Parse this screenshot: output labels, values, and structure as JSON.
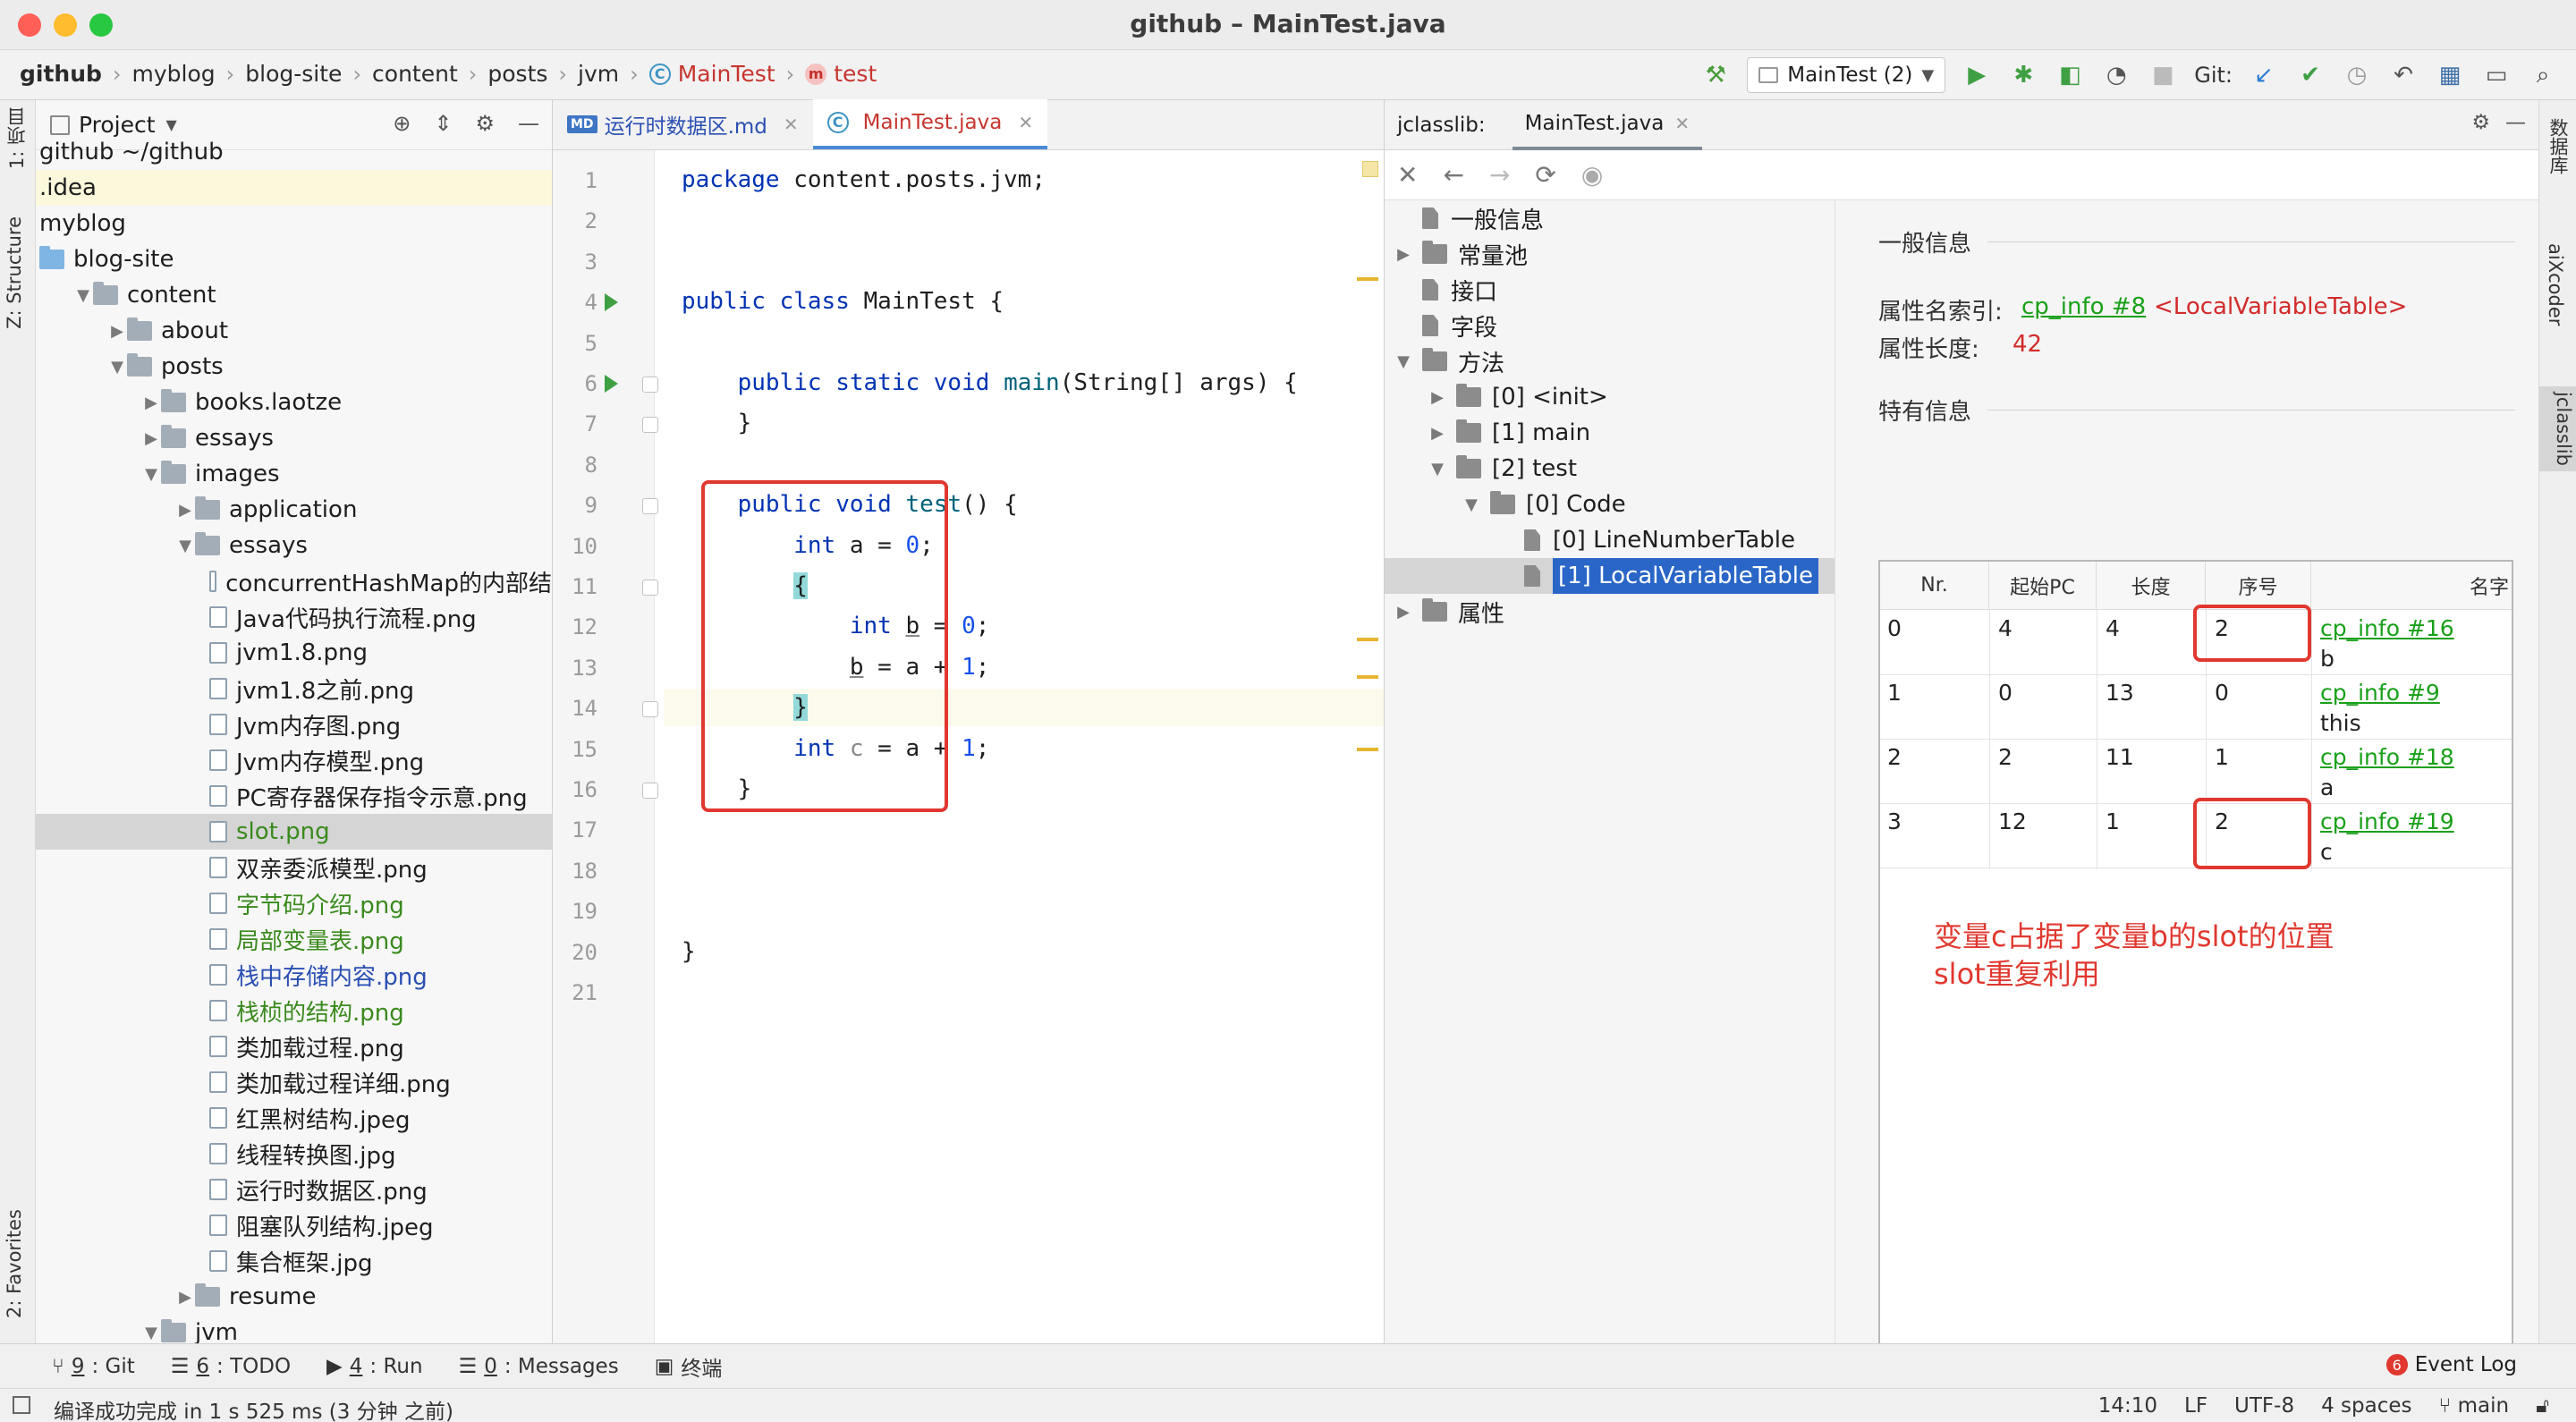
{
  "window": {
    "title": "github – MainTest.java"
  },
  "breadcrumb": [
    "github",
    "myblog",
    "blog-site",
    "content",
    "posts",
    "jvm",
    "MainTest",
    "test"
  ],
  "toolbar": {
    "run_config": "MainTest (2)",
    "git_label": "Git:"
  },
  "left_strip": {
    "project_tab": "1: 项目",
    "structure_tab": "Z: Structure",
    "favorites_tab": "2: Favorites"
  },
  "right_strip": {
    "database_tab": "数据库",
    "aixcoder_tab": "aiXcoder",
    "jclasslib_tab": "jclasslib"
  },
  "project": {
    "title": "Project",
    "tree": [
      {
        "label": "github ~/github",
        "indent": 0,
        "kind": "cut",
        "style": "normal"
      },
      {
        "label": ".idea",
        "indent": 0,
        "kind": "none",
        "style": "highlight"
      },
      {
        "label": "myblog",
        "indent": 0,
        "kind": "none",
        "style": "normal"
      },
      {
        "label": "blog-site",
        "indent": 0,
        "kind": "folder-blue",
        "style": "normal"
      },
      {
        "label": "content",
        "indent": 1,
        "kind": "folder-open",
        "style": "normal"
      },
      {
        "label": "about",
        "indent": 2,
        "kind": "folder-closed",
        "style": "normal"
      },
      {
        "label": "posts",
        "indent": 2,
        "kind": "folder-open",
        "style": "normal"
      },
      {
        "label": "books.laotze",
        "indent": 3,
        "kind": "folder-closed",
        "style": "normal"
      },
      {
        "label": "essays",
        "indent": 3,
        "kind": "folder-closed",
        "style": "normal"
      },
      {
        "label": "images",
        "indent": 3,
        "kind": "folder-open",
        "style": "normal"
      },
      {
        "label": "application",
        "indent": 4,
        "kind": "folder-closed",
        "style": "normal"
      },
      {
        "label": "essays",
        "indent": 4,
        "kind": "folder-open",
        "style": "normal"
      },
      {
        "label": "concurrentHashMap的内部结",
        "indent": 5,
        "kind": "file",
        "style": "normal"
      },
      {
        "label": "Java代码执行流程.png",
        "indent": 5,
        "kind": "file",
        "style": "normal"
      },
      {
        "label": "jvm1.8.png",
        "indent": 5,
        "kind": "file",
        "style": "normal"
      },
      {
        "label": "jvm1.8之前.png",
        "indent": 5,
        "kind": "file",
        "style": "normal"
      },
      {
        "label": "Jvm内存图.png",
        "indent": 5,
        "kind": "file",
        "style": "normal"
      },
      {
        "label": "Jvm内存模型.png",
        "indent": 5,
        "kind": "file",
        "style": "normal"
      },
      {
        "label": "PC寄存器保存指令示意.png",
        "indent": 5,
        "kind": "file",
        "style": "normal"
      },
      {
        "label": "slot.png",
        "indent": 5,
        "kind": "file",
        "style": "selected-green"
      },
      {
        "label": "双亲委派模型.png",
        "indent": 5,
        "kind": "file",
        "style": "normal"
      },
      {
        "label": "字节码介绍.png",
        "indent": 5,
        "kind": "file",
        "style": "green"
      },
      {
        "label": "局部变量表.png",
        "indent": 5,
        "kind": "file",
        "style": "green"
      },
      {
        "label": "栈中存储内容.png",
        "indent": 5,
        "kind": "file",
        "style": "blue"
      },
      {
        "label": "栈桢的结构.png",
        "indent": 5,
        "kind": "file",
        "style": "green"
      },
      {
        "label": "类加载过程.png",
        "indent": 5,
        "kind": "file",
        "style": "normal"
      },
      {
        "label": "类加载过程详细.png",
        "indent": 5,
        "kind": "file",
        "style": "normal"
      },
      {
        "label": "红黑树结构.jpeg",
        "indent": 5,
        "kind": "file",
        "style": "normal"
      },
      {
        "label": "线程转换图.jpg",
        "indent": 5,
        "kind": "file",
        "style": "normal"
      },
      {
        "label": "运行时数据区.png",
        "indent": 5,
        "kind": "file",
        "style": "normal"
      },
      {
        "label": "阻塞队列结构.jpeg",
        "indent": 5,
        "kind": "file",
        "style": "normal"
      },
      {
        "label": "集合框架.jpg",
        "indent": 5,
        "kind": "file",
        "style": "normal"
      },
      {
        "label": "resume",
        "indent": 4,
        "kind": "folder-closed",
        "style": "normal"
      },
      {
        "label": "jvm",
        "indent": 3,
        "kind": "folder-open",
        "style": "normal"
      }
    ]
  },
  "editor": {
    "tabs": [
      {
        "label": "运行时数据区.md",
        "active": false
      },
      {
        "label": "MainTest.java",
        "active": true
      }
    ],
    "line_numbers": [
      "1",
      "2",
      "3",
      "4",
      "5",
      "6",
      "7",
      "8",
      "9",
      "10",
      "11",
      "12",
      "13",
      "14",
      "15",
      "16",
      "17",
      "18",
      "19",
      "20",
      "21"
    ],
    "lines": [
      "package content.posts.jvm;",
      "",
      "",
      "public class MainTest {",
      "",
      "    public static void main(String[] args) {",
      "    }",
      "",
      "    public void test() {",
      "        int a = 0;",
      "        {",
      "            int b = 0;",
      "            b = a + 1;",
      "        }",
      "        int c = a + 1;",
      "    }",
      "",
      "",
      "",
      "}",
      ""
    ]
  },
  "jclasslib": {
    "tab_prefix": "jclasslib:",
    "tab_label": "MainTest.java",
    "tree": [
      {
        "label": "一般信息",
        "indent": 0,
        "kind": "page",
        "arrow": ""
      },
      {
        "label": "常量池",
        "indent": 0,
        "kind": "folder",
        "arrow": "closed"
      },
      {
        "label": "接口",
        "indent": 0,
        "kind": "page",
        "arrow": ""
      },
      {
        "label": "字段",
        "indent": 0,
        "kind": "page",
        "arrow": ""
      },
      {
        "label": "方法",
        "indent": 0,
        "kind": "folder",
        "arrow": "open"
      },
      {
        "label": "[0] <init>",
        "indent": 1,
        "kind": "folder",
        "arrow": "closed"
      },
      {
        "label": "[1] main",
        "indent": 1,
        "kind": "folder",
        "arrow": "closed"
      },
      {
        "label": "[2] test",
        "indent": 1,
        "kind": "folder",
        "arrow": "open"
      },
      {
        "label": "[0] Code",
        "indent": 2,
        "kind": "folder",
        "arrow": "open"
      },
      {
        "label": "[0] LineNumberTable",
        "indent": 3,
        "kind": "page",
        "arrow": ""
      },
      {
        "label": "[1] LocalVariableTable",
        "indent": 3,
        "kind": "page",
        "arrow": "",
        "selected": true
      },
      {
        "label": "属性",
        "indent": 0,
        "kind": "folder",
        "arrow": "closed"
      }
    ],
    "general": {
      "section": "一般信息",
      "name_index_label": "属性名索引:",
      "name_index_link": "cp_info #8",
      "name_index_value": "<LocalVariableTable>",
      "length_label": "属性长度:",
      "length_value": "42"
    },
    "specific": {
      "section": "特有信息",
      "columns": [
        "Nr.",
        "起始PC",
        "长度",
        "序号",
        "名字"
      ],
      "rows": [
        {
          "nr": "0",
          "start_pc": "4",
          "length": "4",
          "index": "2",
          "name_link": "cp_info #16",
          "name": "b"
        },
        {
          "nr": "1",
          "start_pc": "0",
          "length": "13",
          "index": "0",
          "name_link": "cp_info #9",
          "name": "this"
        },
        {
          "nr": "2",
          "start_pc": "2",
          "length": "11",
          "index": "1",
          "name_link": "cp_info #18",
          "name": "a"
        },
        {
          "nr": "3",
          "start_pc": "12",
          "length": "1",
          "index": "2",
          "name_link": "cp_info #19",
          "name": "c"
        }
      ]
    },
    "annotation": {
      "line1": "变量c占据了变量b的slot的位置",
      "line2": "slot重复利用"
    }
  },
  "bottom_tools": [
    {
      "key": "9",
      "label": ": Git"
    },
    {
      "key": "6",
      "label": ": TODO"
    },
    {
      "key": "4",
      "label": ": Run"
    },
    {
      "key": "0",
      "label": ": Messages"
    },
    {
      "key": "",
      "label": "终端"
    }
  ],
  "event_log": {
    "count": "6",
    "label": "Event Log"
  },
  "status": {
    "message": "编译成功完成 in 1 s 525 ms (3 分钟 之前)",
    "position": "14:10",
    "line_sep": "LF",
    "encoding": "UTF-8",
    "indent": "4 spaces",
    "branch": "main"
  }
}
